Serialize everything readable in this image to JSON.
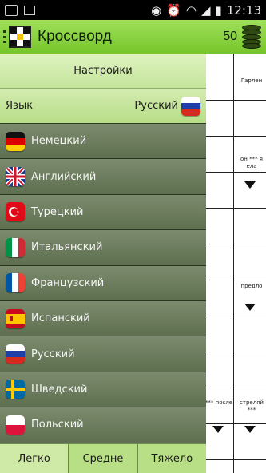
{
  "status": {
    "time": "12:13"
  },
  "app": {
    "title": "Кроссворд",
    "coins": "50"
  },
  "drawer": {
    "header": "Настройки",
    "language_label": "Язык",
    "current_language": "Русский",
    "languages": [
      {
        "label": "Немецкий",
        "flag": "german-flag-icon"
      },
      {
        "label": "Английский",
        "flag": "uk-flag-icon"
      },
      {
        "label": "Турецкий",
        "flag": "turkish-flag-icon"
      },
      {
        "label": "Итальянский",
        "flag": "italian-flag-icon"
      },
      {
        "label": "Французский",
        "flag": "french-flag-icon"
      },
      {
        "label": "Испанский",
        "flag": "spanish-flag-icon"
      },
      {
        "label": "Русский",
        "flag": "russian-flag-icon"
      },
      {
        "label": "Шведский",
        "flag": "swedish-flag-icon"
      },
      {
        "label": "Польский",
        "flag": "polish-flag-icon"
      }
    ],
    "difficulty": {
      "easy": "Легко",
      "medium": "Средне",
      "hard": "Тяжело"
    }
  },
  "grid": {
    "clues": [
      "Гарлен",
      "он *** я ела",
      "предло",
      "*** после",
      "стреляй ***"
    ]
  },
  "colors": {
    "accent": "#8fd44a",
    "drawer": "#5e6f50"
  }
}
